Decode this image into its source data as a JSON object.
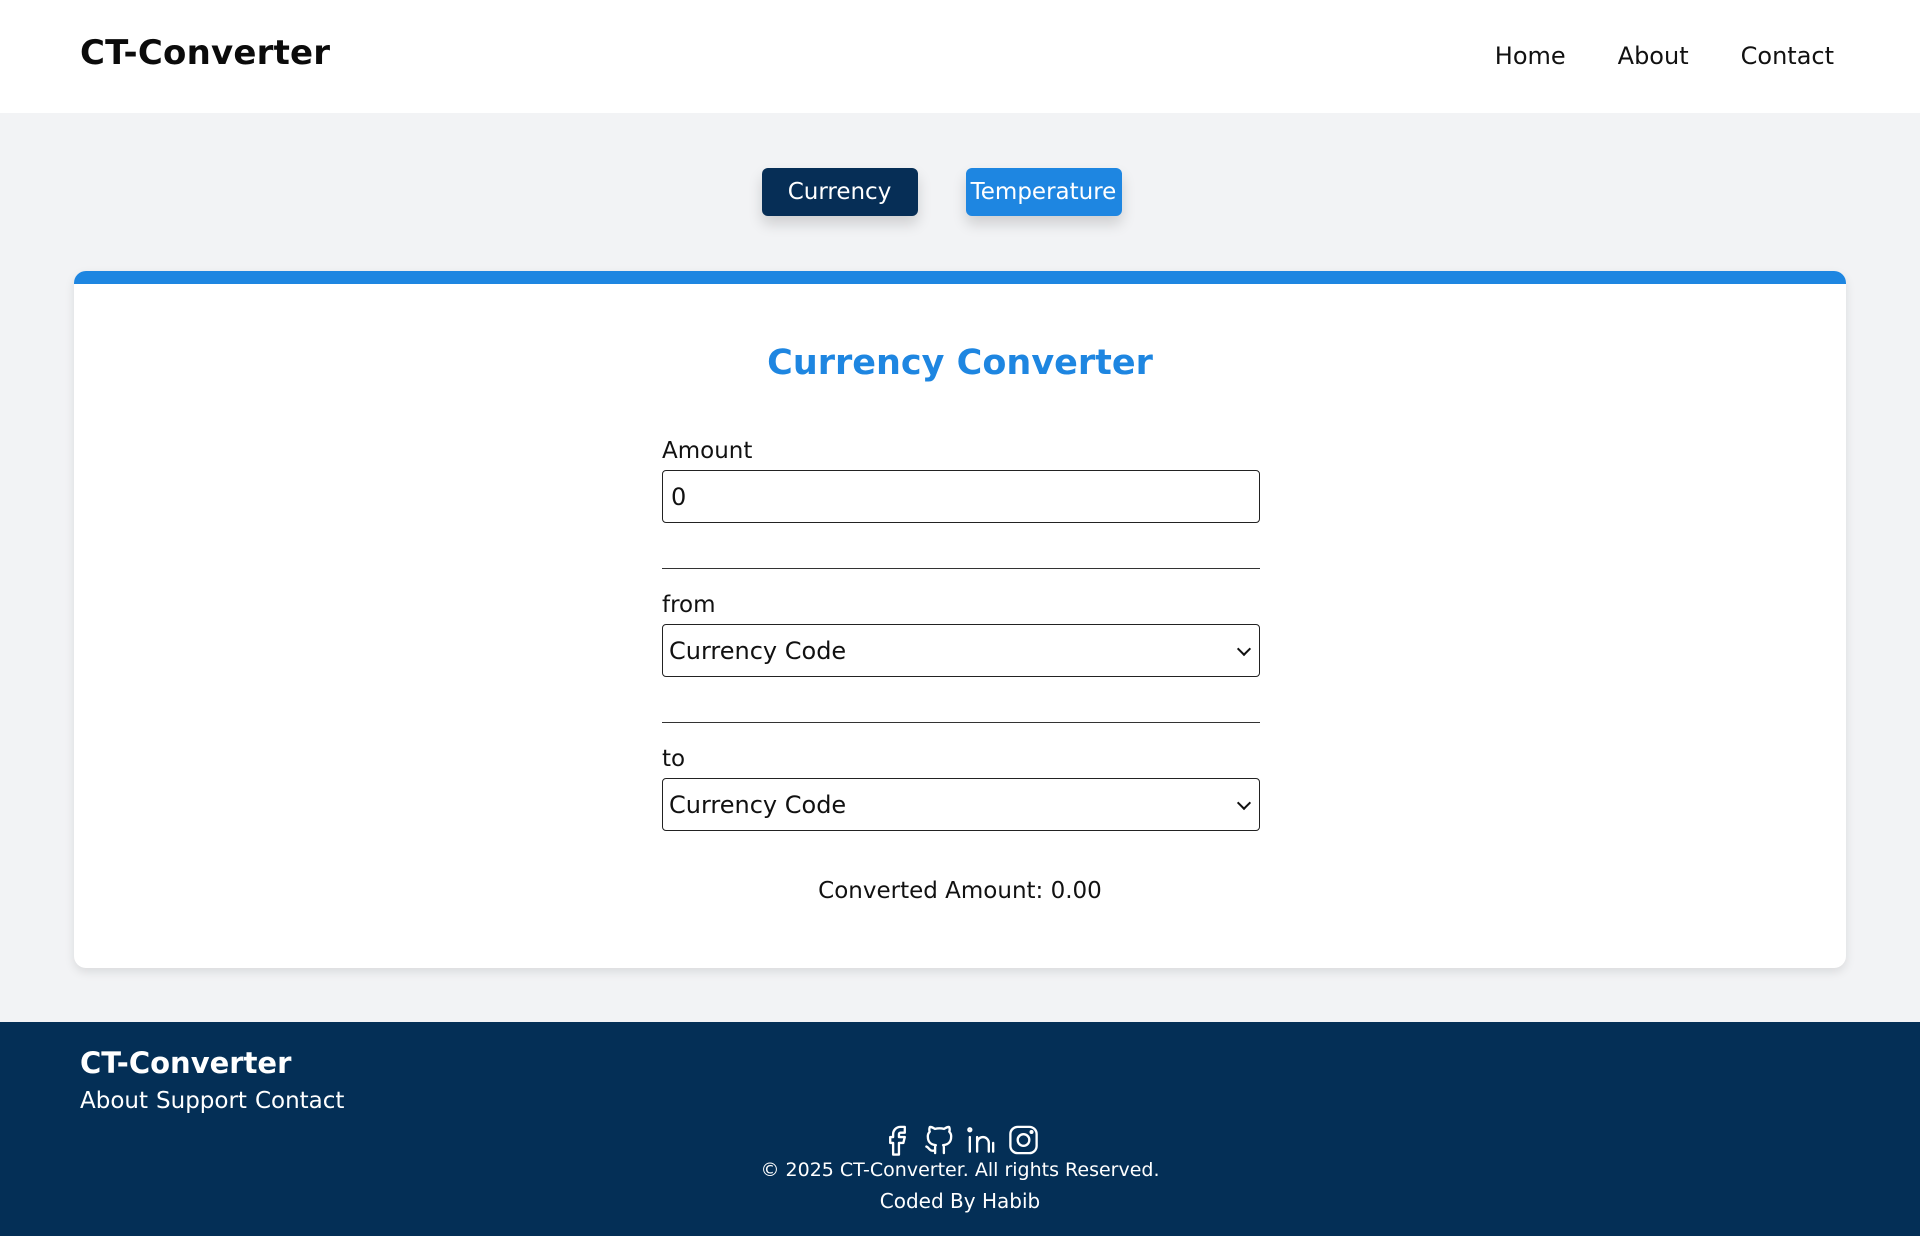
{
  "header": {
    "brand": "CT-Converter",
    "nav": [
      "Home",
      "About",
      "Contact"
    ]
  },
  "tabs": {
    "currency": "Currency",
    "temperature": "Temperature"
  },
  "converter": {
    "title": "Currency Converter",
    "amount_label": "Amount",
    "amount_value": "0",
    "from_label": "from",
    "from_selected": "Currency Code",
    "to_label": "to",
    "to_selected": "Currency Code",
    "result": "Converted Amount: 0.00"
  },
  "footer": {
    "brand": "CT-Converter",
    "links": [
      "About",
      "Support",
      "Contact"
    ],
    "social_icons": [
      "facebook-icon",
      "github-icon",
      "linkedin-icon",
      "instagram-icon"
    ],
    "copyright": "© 2025 CT-Converter. All rights Reserved.",
    "credit": "Coded By Habib"
  },
  "colors": {
    "accent": "#1e86e1",
    "navy": "#062e56",
    "footer_bg": "#042f56",
    "page_bg": "#f2f3f5"
  }
}
